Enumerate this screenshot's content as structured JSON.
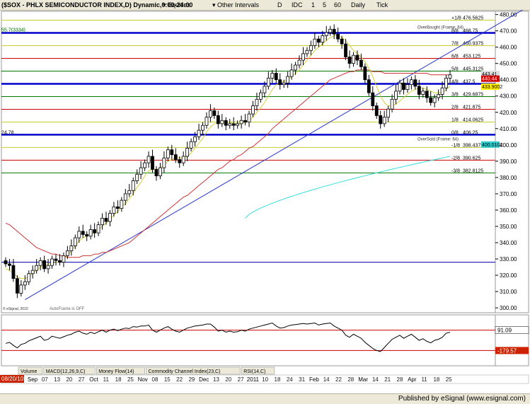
{
  "toolbar": {
    "symbol": "($SOX - PHLX SEMICONDUCTOR INDEX,D) Dynamic,0:00-24:00",
    "equities": "Equities",
    "other_intervals": "Other Intervals",
    "intervals": [
      "D",
      "IDC",
      "1",
      "5",
      "60",
      "Daily",
      "Tick"
    ]
  },
  "status_text": "Published by eSignal (www.esignal.com)",
  "indicator_tabs": [
    "Volume",
    "MACD(12,26,9,C)",
    "Money Flow(14)",
    "Commodity Channel Index(23,C)",
    "RSI(14,C)"
  ],
  "price_label_bottom": "08/20/10",
  "chart_data": {
    "type": "candlestick",
    "title": "($SOX - PHLX SEMICONDUCTOR INDEX,D)",
    "x_labels": [
      "Sep",
      "07",
      "13",
      "20",
      "27",
      "Oct",
      "11",
      "18",
      "25",
      "Nov",
      "08",
      "15",
      "22",
      "29",
      "Dec",
      "13",
      "20",
      "27",
      "2011",
      "10",
      "18",
      "24",
      "31",
      "Feb",
      "14",
      "22",
      "28",
      "Mar",
      "14",
      "21",
      "28",
      "Apr",
      "11",
      "18",
      "25"
    ],
    "y_ticks": [
      300,
      310,
      320,
      330,
      340,
      350,
      360,
      370,
      380,
      390,
      400,
      410,
      420,
      430,
      440,
      450,
      460,
      470,
      480
    ],
    "ylim": [
      297,
      482
    ],
    "murrey_levels": [
      {
        "label": "+1/8",
        "value": 476.5625,
        "color": "#cccc33"
      },
      {
        "label": "8/8",
        "value": 468.75,
        "color": "#0000cc"
      },
      {
        "label": "7/8",
        "value": 460.9375,
        "color": "#cccc33"
      },
      {
        "label": "6/8",
        "value": 453.125,
        "color": "#cc0000"
      },
      {
        "label": "5/8",
        "value": 445.3125,
        "color": "#007700"
      },
      {
        "label": "4/8",
        "value": 437.5,
        "color": "#0000cc"
      },
      {
        "label": "3/8",
        "value": 429.6875,
        "color": "#007700"
      },
      {
        "label": "2/8",
        "value": 421.875,
        "color": "#cc0000"
      },
      {
        "label": "1/8",
        "value": 414.0625,
        "color": "#cccc33"
      },
      {
        "label": "0/8",
        "value": 406.25,
        "color": "#0000cc"
      },
      {
        "label": "-1/8",
        "value": 398.4375,
        "color": "#cccc33"
      },
      {
        "label": "-2/8",
        "value": 390.625,
        "color": "#cc0000"
      },
      {
        "label": "-3/8",
        "value": 382.8125,
        "color": "#007700"
      }
    ],
    "annotations": {
      "overbought": "OverBought (Frame: 64)",
      "oversold": "OverSold (Frame: 64)",
      "autoframe": "AutoFrame is OFF",
      "copyright": "© eSignal, 2010",
      "left_tag_top": "55.7(3334)",
      "left_tag_mid": "24.78",
      "price_tag_1": "443.41",
      "price_tag_2": "440.44",
      "price_tag_3": "433.9002",
      "price_tag_4": "400.0102"
    },
    "closes": [
      327,
      326,
      318,
      309,
      314,
      316,
      321,
      323,
      326,
      329,
      324,
      326,
      330,
      329,
      328,
      332,
      335,
      338,
      343,
      347,
      345,
      344,
      348,
      346,
      351,
      355,
      353,
      358,
      362,
      361,
      366,
      370,
      372,
      378,
      382,
      386,
      389,
      393,
      385,
      381,
      386,
      392,
      397,
      394,
      391,
      389,
      393,
      398,
      402,
      405,
      409,
      412,
      417,
      421,
      418,
      413,
      415,
      412,
      413,
      412,
      413,
      415,
      414,
      419,
      424,
      428,
      432,
      436,
      441,
      444,
      440,
      437,
      438,
      442,
      446,
      449,
      452,
      456,
      458,
      461,
      465,
      463,
      467,
      469,
      471,
      468,
      465,
      462,
      454,
      450,
      455,
      452,
      448,
      440,
      432,
      424,
      418,
      413,
      417,
      422,
      428,
      433,
      438,
      434,
      437,
      440,
      436,
      431,
      433,
      429,
      426,
      429,
      431,
      435,
      441,
      443
    ],
    "ma_short": [
      324,
      323,
      321,
      319,
      318,
      318,
      319,
      321,
      323,
      325,
      326,
      327,
      327,
      328,
      328,
      330,
      332,
      335,
      338,
      341,
      343,
      344,
      345,
      346,
      348,
      350,
      352,
      354,
      357,
      359,
      362,
      364,
      367,
      370,
      374,
      377,
      381,
      384,
      385,
      385,
      386,
      388,
      390,
      391,
      392,
      392,
      392,
      393,
      395,
      398,
      401,
      404,
      408,
      411,
      413,
      414,
      414,
      414,
      414,
      413,
      413,
      413,
      414,
      415,
      417,
      420,
      423,
      426,
      430,
      434,
      437,
      438,
      439,
      440,
      442,
      444,
      446,
      449,
      452,
      455,
      458,
      460,
      462,
      464,
      466,
      467,
      467,
      466,
      464,
      461,
      458,
      456,
      454,
      451,
      447,
      442,
      436,
      430,
      426,
      424,
      424,
      425,
      427,
      429,
      431,
      433,
      434,
      435,
      435,
      434,
      433,
      432,
      432,
      432,
      434,
      436
    ],
    "ma_long": [
      352,
      351,
      349,
      347,
      345,
      343,
      341,
      339,
      337,
      336,
      335,
      334,
      333,
      333,
      332,
      332,
      331,
      331,
      331,
      331,
      332,
      332,
      332,
      333,
      333,
      334,
      334,
      335,
      336,
      337,
      338,
      339,
      340,
      342,
      344,
      346,
      348,
      350,
      352,
      354,
      356,
      358,
      360,
      362,
      364,
      366,
      368,
      369,
      371,
      373,
      375,
      377,
      379,
      381,
      383,
      385,
      386,
      388,
      390,
      391,
      393,
      394,
      396,
      398,
      399,
      401,
      403,
      405,
      407,
      410,
      412,
      414,
      416,
      418,
      420,
      422,
      424,
      426,
      428,
      430,
      432,
      434,
      436,
      438,
      440,
      441,
      442,
      443,
      444,
      445,
      445,
      446,
      446,
      446,
      446,
      445,
      445,
      445,
      444,
      444,
      444,
      444,
      444,
      444,
      444,
      444,
      444,
      444,
      444,
      444,
      443,
      443,
      443,
      443,
      443,
      443
    ],
    "cyan_line": {
      "start_index": 62,
      "values_start": 355,
      "values_end": 393
    },
    "trendline": {
      "start": [
        5,
        305
      ],
      "end": [
        136,
        486
      ]
    },
    "horizontal_blue_line": 328,
    "rsi_values": [
      44,
      46,
      40,
      35,
      42,
      44,
      49,
      52,
      55,
      58,
      50,
      52,
      58,
      56,
      54,
      57,
      60,
      62,
      66,
      68,
      64,
      62,
      66,
      63,
      67,
      70,
      66,
      70,
      72,
      69,
      72,
      74,
      73,
      77,
      76,
      78,
      78,
      80,
      70,
      66,
      70,
      74,
      77,
      72,
      68,
      66,
      70,
      74,
      76,
      78,
      79,
      80,
      82,
      82,
      76,
      68,
      70,
      66,
      68,
      66,
      67,
      70,
      68,
      72,
      74,
      76,
      78,
      80,
      82,
      84,
      78,
      74,
      75,
      78,
      80,
      81,
      82,
      83,
      82,
      83,
      84,
      80,
      82,
      83,
      84,
      78,
      74,
      70,
      60,
      56,
      62,
      58,
      54,
      46,
      40,
      34,
      30,
      28,
      36,
      44,
      52,
      56,
      60,
      54,
      58,
      62,
      56,
      50,
      53,
      48,
      45,
      50,
      52,
      56,
      64,
      66
    ],
    "rsi_labels": [
      "91.09",
      "-179.57"
    ]
  }
}
